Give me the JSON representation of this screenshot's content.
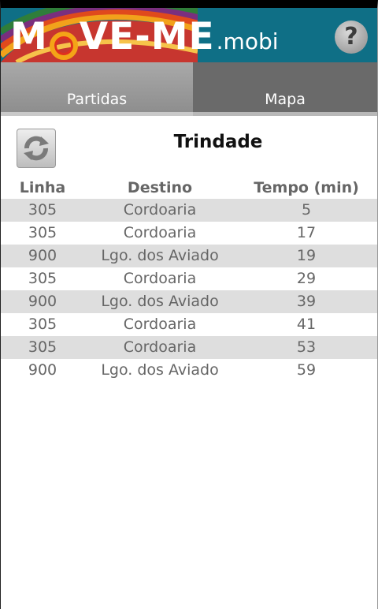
{
  "app": {
    "logo_main_left": "M",
    "logo_main_right": "VE-ME",
    "logo_suffix": ".mobi",
    "help_glyph": "?"
  },
  "tabs": [
    {
      "label": "Partidas",
      "active": true
    },
    {
      "label": "Mapa",
      "active": false
    }
  ],
  "stop": {
    "name": "Trindade"
  },
  "refresh_icon": "refresh-icon",
  "table": {
    "headers": [
      "Linha",
      "Destino",
      "Tempo (min)"
    ],
    "rows": [
      [
        "305",
        "Cordoaria",
        "5"
      ],
      [
        "305",
        "Cordoaria",
        "17"
      ],
      [
        "900",
        "Lgo. dos Aviado",
        "19"
      ],
      [
        "305",
        "Cordoaria",
        "29"
      ],
      [
        "900",
        "Lgo. dos Aviado",
        "39"
      ],
      [
        "305",
        "Cordoaria",
        "41"
      ],
      [
        "305",
        "Cordoaria",
        "53"
      ],
      [
        "900",
        "Lgo. dos Aviado",
        "59"
      ]
    ]
  },
  "colors": {
    "header_bg": "#0f6f86",
    "row_shade": "#dedede",
    "text_gray": "#666666"
  }
}
